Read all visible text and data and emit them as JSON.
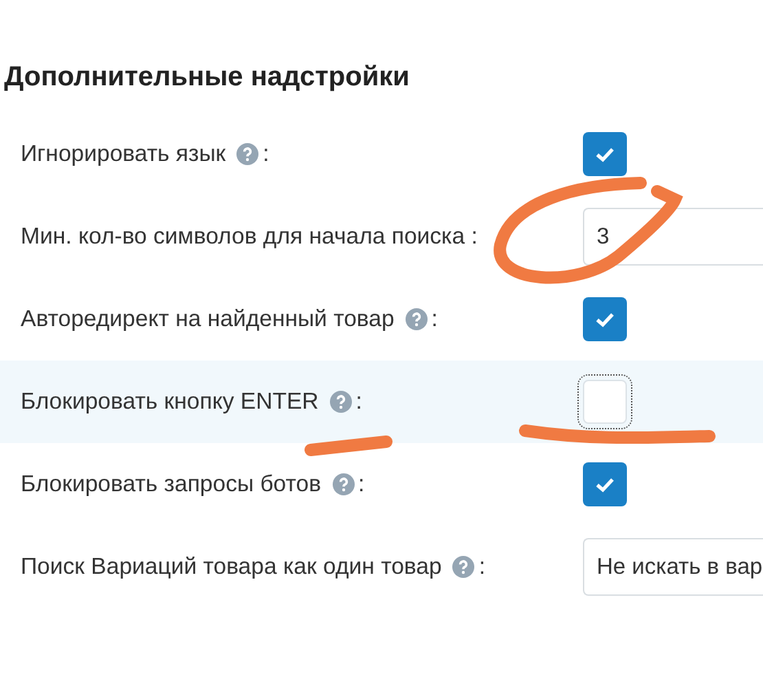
{
  "section": {
    "title": "Дополнительные надстройки"
  },
  "rows": [
    {
      "label": "Игнорировать язык",
      "help": true,
      "suffix": ":",
      "kind": "checkbox",
      "checked": true,
      "highlighted": false
    },
    {
      "label": "Мин. кол-во символов для начала поиска",
      "help": false,
      "suffix": " :",
      "kind": "number",
      "value": "3",
      "highlighted": false
    },
    {
      "label": "Авторедирект на найденный товар",
      "help": true,
      "suffix": ":",
      "kind": "checkbox",
      "checked": true,
      "highlighted": false
    },
    {
      "label": "Блокировать кнопку ENTER",
      "help": true,
      "suffix": ":",
      "kind": "checkbox",
      "checked": false,
      "highlighted": true
    },
    {
      "label": "Блокировать запросы ботов",
      "help": true,
      "suffix": ":",
      "kind": "checkbox",
      "checked": true,
      "highlighted": false
    },
    {
      "label": "Поиск Вариаций товара как один товар",
      "help": true,
      "suffix": ":",
      "kind": "select",
      "value": "Не искать в вар",
      "highlighted": false
    }
  ]
}
